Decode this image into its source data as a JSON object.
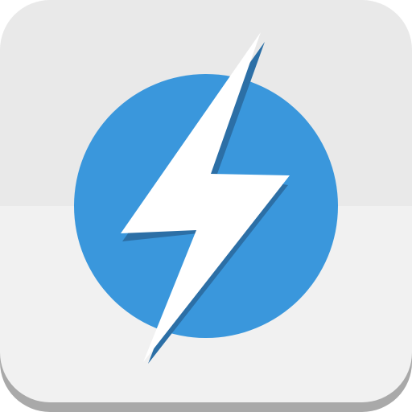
{
  "app_icon": {
    "icon_name": "lightning-bolt-icon",
    "colors": {
      "tile_top": "#E9E9E9",
      "tile_bottom": "#F1F1F1",
      "tile_edge": "#A9A9A9",
      "circle": "#3A97DC",
      "bolt": "#FFFFFF",
      "bolt_shadow": "#2C6FA6"
    }
  }
}
